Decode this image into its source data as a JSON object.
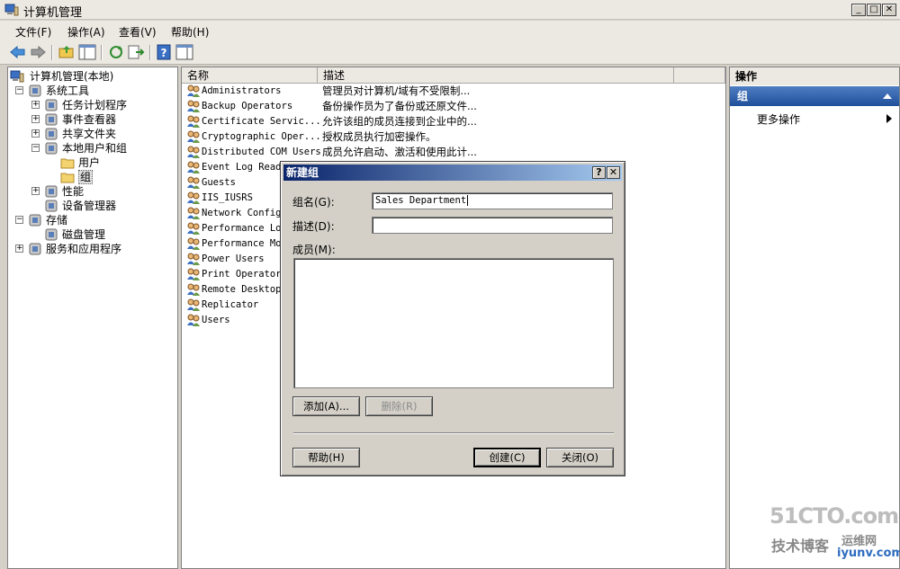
{
  "window": {
    "title": "计算机管理"
  },
  "menu": [
    "文件(F)",
    "操作(A)",
    "查看(V)",
    "帮助(H)"
  ],
  "tree": {
    "root": "计算机管理(本地)",
    "items": [
      {
        "label": "系统工具",
        "level": 1,
        "expander": "−"
      },
      {
        "label": "任务计划程序",
        "level": 2,
        "expander": "+"
      },
      {
        "label": "事件查看器",
        "level": 2,
        "expander": "+"
      },
      {
        "label": "共享文件夹",
        "level": 2,
        "expander": "+"
      },
      {
        "label": "本地用户和组",
        "level": 2,
        "expander": "−"
      },
      {
        "label": "用户",
        "level": 3,
        "expander": ""
      },
      {
        "label": "组",
        "level": 3,
        "expander": "",
        "selected": true
      },
      {
        "label": "性能",
        "level": 2,
        "expander": "+"
      },
      {
        "label": "设备管理器",
        "level": 2,
        "expander": ""
      },
      {
        "label": "存储",
        "level": 1,
        "expander": "−"
      },
      {
        "label": "磁盘管理",
        "level": 2,
        "expander": ""
      },
      {
        "label": "服务和应用程序",
        "level": 1,
        "expander": "+"
      }
    ]
  },
  "list": {
    "columns": [
      "名称",
      "描述"
    ],
    "rows": [
      {
        "name": "Administrators",
        "desc": "管理员对计算机/域有不受限制..."
      },
      {
        "name": "Backup Operators",
        "desc": "备份操作员为了备份或还原文件..."
      },
      {
        "name": "Certificate Servic...",
        "desc": "允许该组的成员连接到企业中的..."
      },
      {
        "name": "Cryptographic Oper...",
        "desc": "授权成员执行加密操作。"
      },
      {
        "name": "Distributed COM Users",
        "desc": "成员允许启动、激活和使用此计..."
      },
      {
        "name": "Event Log Reade",
        "desc": ""
      },
      {
        "name": "Guests",
        "desc": ""
      },
      {
        "name": "IIS_IUSRS",
        "desc": ""
      },
      {
        "name": "Network Configu",
        "desc": ""
      },
      {
        "name": "Performance Log",
        "desc": ""
      },
      {
        "name": "Performance Mor",
        "desc": ""
      },
      {
        "name": "Power Users",
        "desc": ""
      },
      {
        "name": "Print Operators",
        "desc": ""
      },
      {
        "name": "Remote Desktop",
        "desc": ""
      },
      {
        "name": "Replicator",
        "desc": ""
      },
      {
        "name": "Users",
        "desc": ""
      }
    ]
  },
  "actions": {
    "header": "操作",
    "group": "组",
    "more": "更多操作"
  },
  "dialog": {
    "title": "新建组",
    "help_btn": "?",
    "close_btn": "✕",
    "group_name_label": "组名(G):",
    "group_name_value": "Sales Department",
    "desc_label": "描述(D):",
    "desc_value": "",
    "members_label": "成员(M):",
    "add_button": "添加(A)...",
    "remove_button": "删除(R)",
    "help_button": "帮助(H)",
    "create_button": "创建(C)",
    "close_button": "关闭(O)"
  },
  "watermark": {
    "big": "51CTO.com",
    "small": "技术博客",
    "yw": "运维网",
    "site": "iyunv.com"
  },
  "colors": {
    "title_gradient_start": "#0a246a",
    "title_gradient_end": "#a6caf0",
    "selection": "#316ac5"
  }
}
